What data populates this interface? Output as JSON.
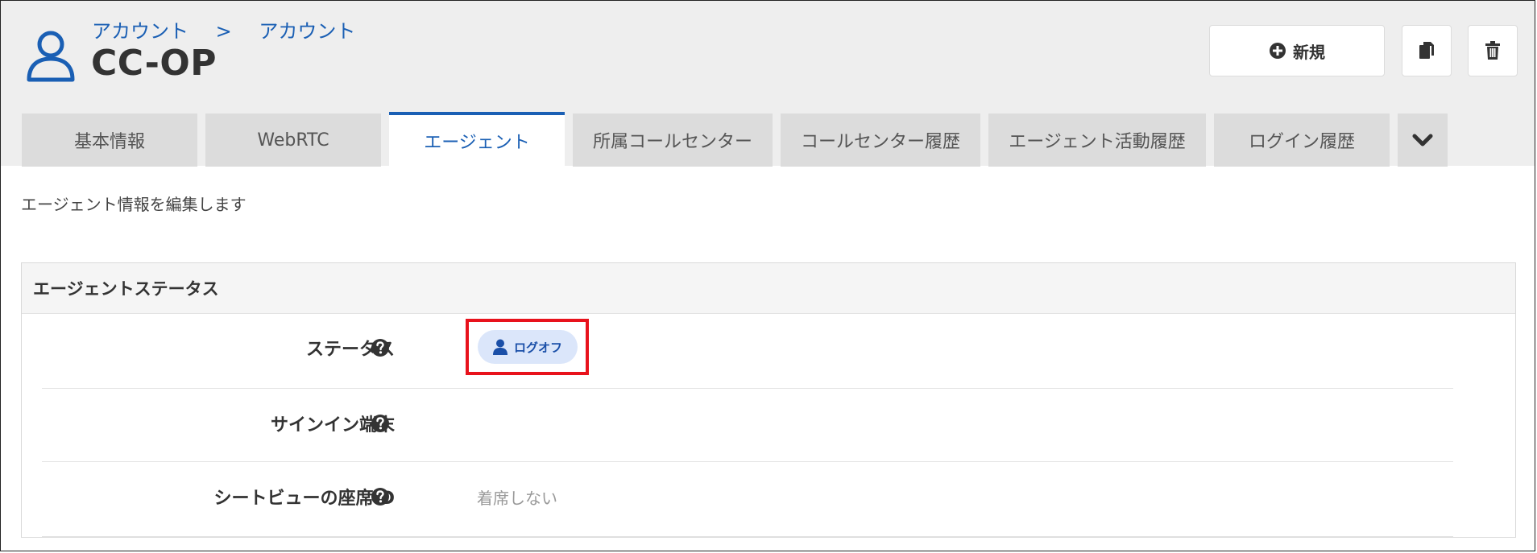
{
  "header": {
    "breadcrumb": [
      "アカウント",
      "アカウント"
    ],
    "breadcrumb_separator": ">",
    "title": "CC-OP",
    "new_button_label": "新規"
  },
  "tabs": [
    {
      "label": "基本情報",
      "active": false
    },
    {
      "label": "WebRTC",
      "active": false
    },
    {
      "label": "エージェント",
      "active": true
    },
    {
      "label": "所属コールセンター",
      "active": false
    },
    {
      "label": "コールセンター履歴",
      "active": false
    },
    {
      "label": "エージェント活動履歴",
      "active": false
    },
    {
      "label": "ログイン履歴",
      "active": false
    }
  ],
  "description": "エージェント情報を編集します",
  "panel": {
    "title": "エージェントステータス",
    "rows": [
      {
        "label": "ステータス",
        "value": ""
      },
      {
        "label": "サインイン端末",
        "value": ""
      },
      {
        "label": "シートビューの座席ID",
        "value": "着席しない"
      }
    ],
    "status_badge": "ログオフ"
  },
  "colors": {
    "accent": "#1a5fb4",
    "highlight_border": "#e8121c",
    "badge_bg": "#dbe6fa",
    "header_bg": "#eeeeee"
  },
  "icons": [
    "account-user-icon",
    "plus-circle-icon",
    "copy-icon",
    "trash-icon",
    "chevron-down-icon",
    "help-circle-icon",
    "user-icon"
  ]
}
